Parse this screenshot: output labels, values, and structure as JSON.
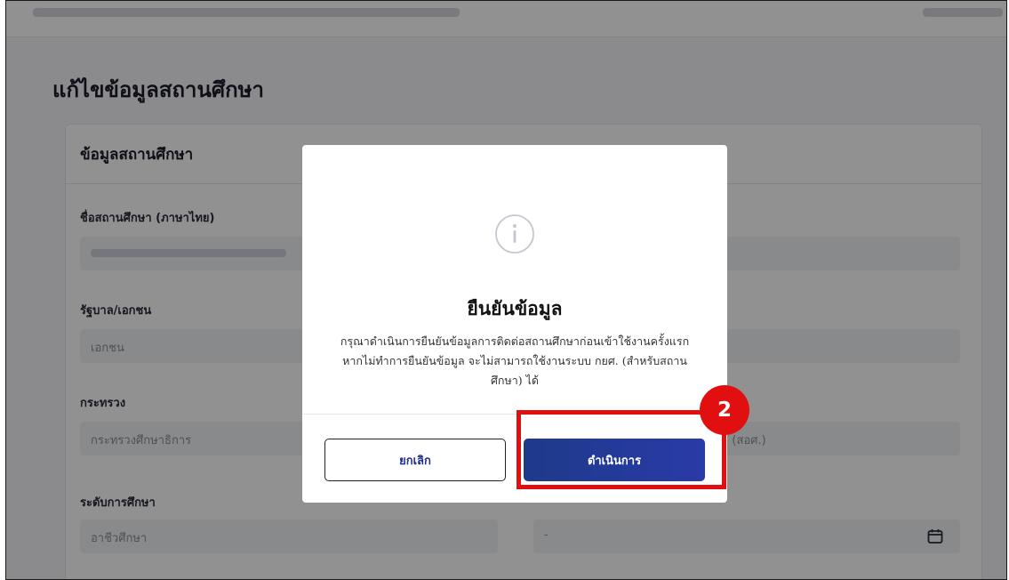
{
  "page": {
    "title": "แก้ไขข้อมูลสถานศึกษา"
  },
  "card": {
    "title": "ข้อมูลสถานศึกษา",
    "fields": {
      "school_name_th": {
        "label": "ชื่อสถานศึกษา (ภาษาไทย)"
      },
      "government_private": {
        "label": "รัฐบาล/เอกชน",
        "value": "เอกชน"
      },
      "ministry": {
        "label": "กระทรวง",
        "value": "กระทรวงศึกษาธิการ"
      },
      "affiliation": {
        "value": "า (สอศ.)"
      },
      "education_level": {
        "label": "ระดับการศึกษา",
        "value": "อาชีวศึกษา"
      },
      "date": {
        "value": "-"
      }
    }
  },
  "modal": {
    "title": "ยืนยันข้อมูล",
    "message": "กรุณาดำเนินการยืนยันข้อมูลการติดต่อสถานศึกษาก่อนเข้าใช้งานครั้งแรก หากไม่ทำการยืนยันข้อมูล จะไม่สามารถใช้งานระบบ กยศ. (สำหรับสถานศึกษา) ได้",
    "cancel_label": "ยกเลิก",
    "confirm_label": "ดำเนินการ"
  },
  "annotation": {
    "step_number": "2",
    "color": "#e10f0f"
  },
  "colors": {
    "primary": "#1e3a8a",
    "overlay": "rgba(0,0,0,0.43)"
  },
  "icons": {
    "modal": "info-icon",
    "date_field": "calendar-icon"
  }
}
